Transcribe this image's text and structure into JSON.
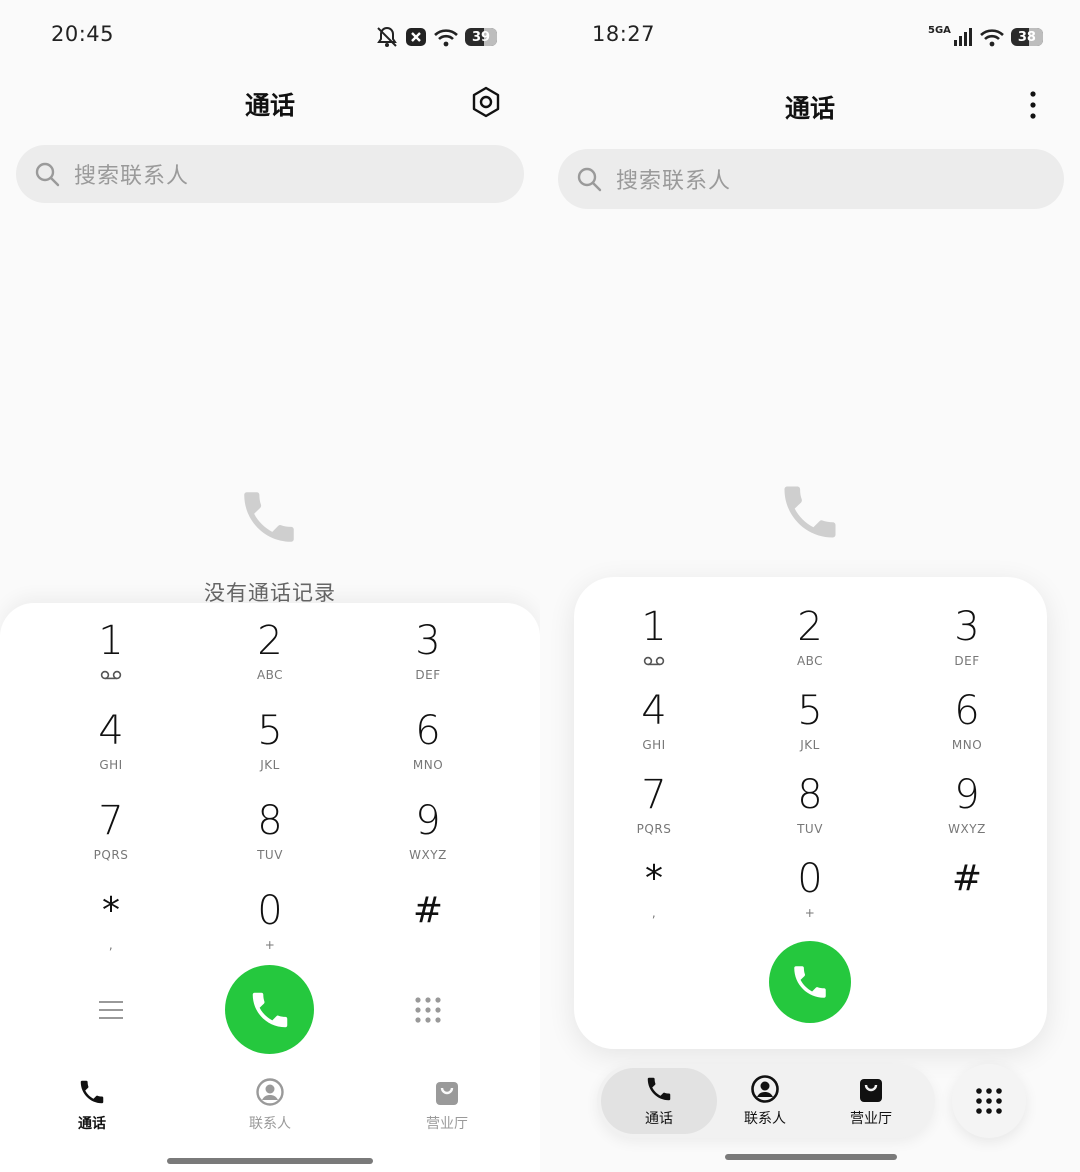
{
  "left": {
    "status": {
      "time": "20:45",
      "battery": "39"
    },
    "header": {
      "title": "通话",
      "settings_icon": "settings-hex-icon"
    },
    "search": {
      "placeholder": "搜索联系人"
    },
    "empty": {
      "icon": "phone-icon",
      "text": "没有通话记录"
    },
    "keys": [
      {
        "num": "1",
        "sub": ""
      },
      {
        "num": "2",
        "sub": "ABC"
      },
      {
        "num": "3",
        "sub": "DEF"
      },
      {
        "num": "4",
        "sub": "GHI"
      },
      {
        "num": "5",
        "sub": "JKL"
      },
      {
        "num": "6",
        "sub": "MNO"
      },
      {
        "num": "7",
        "sub": "PQRS"
      },
      {
        "num": "8",
        "sub": "TUV"
      },
      {
        "num": "9",
        "sub": "WXYZ"
      },
      {
        "num": "*",
        "sub": ","
      },
      {
        "num": "0",
        "sub": "+"
      },
      {
        "num": "#",
        "sub": ""
      }
    ],
    "tabs": [
      {
        "label": "通话",
        "icon": "phone-icon",
        "active": true
      },
      {
        "label": "联系人",
        "icon": "contact-icon",
        "active": false
      },
      {
        "label": "营业厅",
        "icon": "shop-bag-icon",
        "active": false
      }
    ]
  },
  "right": {
    "status": {
      "time": "18:27",
      "battery": "38",
      "network": "5GA"
    },
    "header": {
      "title": "通话",
      "menu_icon": "more-vertical-icon"
    },
    "search": {
      "placeholder": "搜索联系人"
    },
    "empty": {
      "icon": "phone-icon"
    },
    "keys": [
      {
        "num": "1",
        "sub": ""
      },
      {
        "num": "2",
        "sub": "ABC"
      },
      {
        "num": "3",
        "sub": "DEF"
      },
      {
        "num": "4",
        "sub": "GHI"
      },
      {
        "num": "5",
        "sub": "JKL"
      },
      {
        "num": "6",
        "sub": "MNO"
      },
      {
        "num": "7",
        "sub": "PQRS"
      },
      {
        "num": "8",
        "sub": "TUV"
      },
      {
        "num": "9",
        "sub": "WXYZ"
      },
      {
        "num": "*",
        "sub": ","
      },
      {
        "num": "0",
        "sub": "+"
      },
      {
        "num": "#",
        "sub": ""
      }
    ],
    "tabs": [
      {
        "label": "通话",
        "icon": "phone-icon",
        "active": true
      },
      {
        "label": "联系人",
        "icon": "contact-icon",
        "active": false
      },
      {
        "label": "营业厅",
        "icon": "shop-bag-icon",
        "active": false
      }
    ]
  },
  "colors": {
    "call_green": "#25c83e",
    "inactive_gray": "#9a9a9a"
  }
}
